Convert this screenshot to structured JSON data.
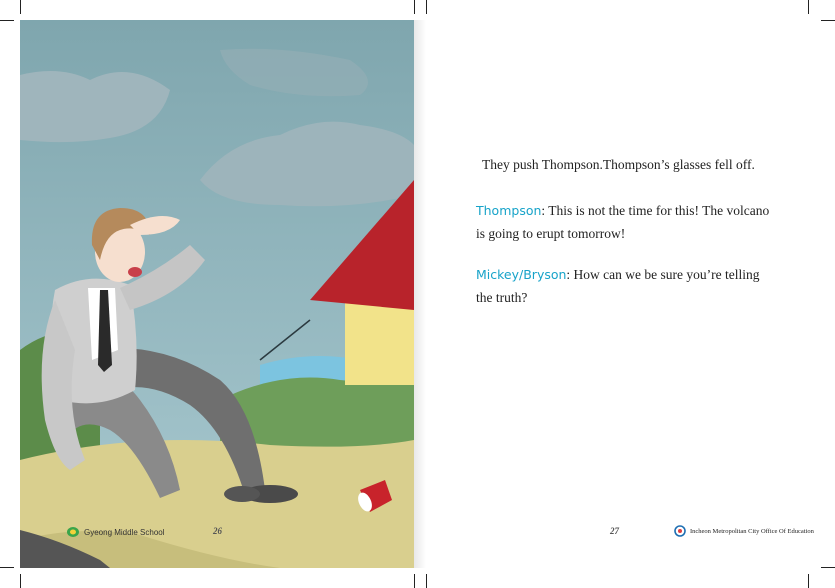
{
  "left_page": {
    "school_name": "Gyeong Middle School",
    "page_number": "26"
  },
  "right_page": {
    "page_number": "27",
    "publisher": "Incheon Metropolitan City Office Of Education",
    "narration": "They push Thompson.Thompson’s glasses fell off.",
    "dialogue": [
      {
        "speaker": "Thompson",
        "text": ": This is not the time for this! The volcano is going to erupt tomorrow!"
      },
      {
        "speaker": "Mickey/Bryson",
        "text": ": How can we be sure you’re telling the truth?"
      }
    ]
  },
  "colors": {
    "speaker": "#17a3c9",
    "sky": "#8fb4bd",
    "ground": "#d9cf8e"
  }
}
